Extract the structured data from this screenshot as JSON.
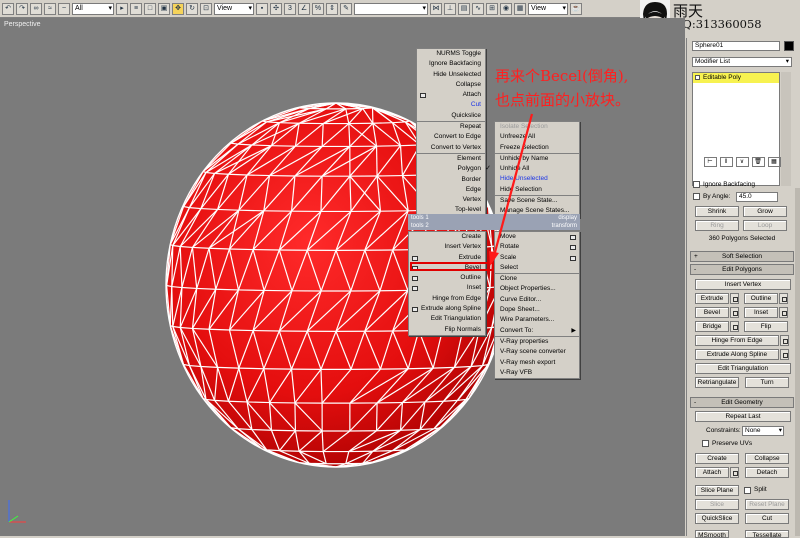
{
  "toolbar": {
    "selection_filter": "All",
    "ref_coord_1": "View",
    "ref_coord_2": "View"
  },
  "viewport": {
    "label": "Perspective"
  },
  "watermark": {
    "name": "雨天",
    "qq": "QQ:313360058"
  },
  "annotation": {
    "line1": "再来个Becel(倒角),",
    "line2": "也点前面的小放块。",
    "color": "#ff2020"
  },
  "quad_left_top": [
    "NURMS Toggle",
    "Ignore Backfacing",
    "Hide Unselected",
    "Collapse",
    "Attach",
    "Cut",
    "Quickslice",
    "Repeat",
    "Convert to Edge",
    "Convert to Vertex",
    "Element",
    "Polygon",
    "Border",
    "Edge",
    "Vertex",
    "Top-level"
  ],
  "quad_right_top": [
    "Isolate Selection",
    "Unfreeze All",
    "Freeze Selection",
    "Unhide by Name",
    "Unhide All",
    "Hide Unselected",
    "Hide Selection",
    "Save Scene State...",
    "Manage Scene States..."
  ],
  "quad_headers": {
    "tools1": "tools 1",
    "tools2": "tools 2",
    "display": "display",
    "transform": "transform"
  },
  "quad_left_bottom": [
    "Create",
    "Insert Vertex",
    "Extrude",
    "Bevel",
    "Outline",
    "Inset",
    "Hinge from Edge",
    "Extrude along Spline",
    "Edit Triangulation",
    "Flip Normals"
  ],
  "quad_right_bottom": [
    "Move",
    "Rotate",
    "Scale",
    "Select",
    "Clone",
    "Object Properties...",
    "Curve Editor...",
    "Dope Sheet...",
    "Wire Parameters...",
    "Convert To:",
    "V-Ray properties",
    "V-Ray scene converter",
    "V-Ray mesh export",
    "V-Ray VFB"
  ],
  "panel": {
    "object_name": "Sphere01",
    "modifier_list": "Modifier List",
    "stack_item": "Editable Poly",
    "ignore_backfacing": "Ignore Backfacing",
    "by_angle": "By Angle:",
    "by_angle_value": "45.0",
    "shrink": "Shrink",
    "grow": "Grow",
    "ring": "Ring",
    "loop": "Loop",
    "selection_status": "360 Polygons Selected",
    "soft_selection": "Soft Selection",
    "edit_polygons": "Edit Polygons",
    "insert_vertex": "Insert Vertex",
    "extrude": "Extrude",
    "outline": "Outline",
    "bevel": "Bevel",
    "inset": "Inset",
    "bridge": "Bridge",
    "flip": "Flip",
    "hinge_from_edge": "Hinge From Edge",
    "extrude_along_spline": "Extrude Along Spline",
    "edit_triangulation": "Edit Triangulation",
    "retriangulate": "Retriangulate",
    "turn": "Turn",
    "edit_geometry": "Edit Geometry",
    "repeat_last": "Repeat Last",
    "constraints": "Constraints:",
    "constraints_value": "None",
    "preserve_uvs": "Preserve UVs",
    "create": "Create",
    "collapse": "Collapse",
    "attach": "Attach",
    "detach": "Detach",
    "slice_plane": "Slice Plane",
    "split": "Split",
    "slice": "Slice",
    "reset_plane": "Reset Plane",
    "quickslice": "QuickSlice",
    "cut": "Cut",
    "msmooth": "MSmooth",
    "tessellate": "Tessellate"
  }
}
